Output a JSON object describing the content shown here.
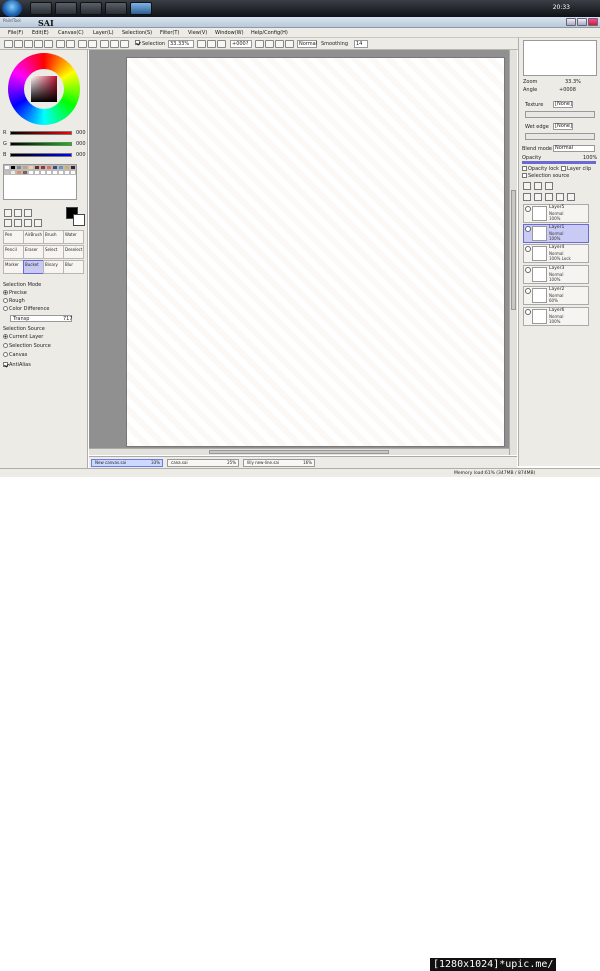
{
  "taskbar": {
    "clock": "20:33"
  },
  "window": {
    "title": "SAI",
    "subtitle": "PaintTool"
  },
  "menu": [
    "File(F)",
    "Edit(E)",
    "Canvas(C)",
    "Layer(L)",
    "Selection(S)",
    "Filter(T)",
    "View(V)",
    "Window(W)",
    "Help/Config(H)"
  ],
  "toolbar": {
    "selection_label": "Selection",
    "zoom": "33.33%",
    "angle": "+000?",
    "mode": "Normal",
    "smoothing_label": "Smoothing",
    "smoothing_value": "14"
  },
  "color": {
    "r_label": "R",
    "r_value": "000",
    "g_label": "G",
    "g_value": "000",
    "b_label": "B",
    "b_value": "000",
    "selected": "#c01030"
  },
  "tools": [
    {
      "label": "Pen"
    },
    {
      "label": "AirBrush"
    },
    {
      "label": "Brush"
    },
    {
      "label": "Water"
    },
    {
      "label": "Pencil"
    },
    {
      "label": "Eraser"
    },
    {
      "label": "Select"
    },
    {
      "label": "Deselect"
    },
    {
      "label": "Marker"
    },
    {
      "label": "Bucket"
    },
    {
      "label": "Binary"
    },
    {
      "label": "Blur"
    }
  ],
  "selection_mode": {
    "title": "Selection Mode",
    "options": [
      "Precise",
      "Rough",
      "Color Difference"
    ],
    "threshold_label": "Transp",
    "threshold_value": "717"
  },
  "selection_source": {
    "title": "Selection Source",
    "options": [
      "Current Layer",
      "Selection Source",
      "Canvas"
    ],
    "antialias": "AntiAlias"
  },
  "file_tabs": [
    {
      "name": "New canvas.sai",
      "pct": "33%"
    },
    {
      "name": "cana.sai",
      "pct": "25%"
    },
    {
      "name": "lilly new-line.sai",
      "pct": "16%"
    }
  ],
  "right": {
    "zoom_label": "Zoom",
    "zoom_value": "33.3%",
    "angle_label": "Angle",
    "angle_value": "+0008",
    "texture_label": "Texture",
    "texture_value": "[None]",
    "wetedge_label": "Wet edge",
    "wetedge_value": "[None]",
    "blend_label": "Blend mode",
    "blend_value": "Normal",
    "opacity_label": "Opacity",
    "opacity_value": "100%",
    "opacity_lock": "Opacity lock",
    "layer_clip": "Layer clip",
    "selection_source": "Selection source"
  },
  "layers": [
    {
      "name": "Layer5",
      "mode": "Normal",
      "opacity": "100%"
    },
    {
      "name": "Layer1",
      "mode": "Normal",
      "opacity": "100%"
    },
    {
      "name": "Layer4",
      "mode": "Normal",
      "opacity": "100% Lock"
    },
    {
      "name": "Layer3",
      "mode": "Normal",
      "opacity": "100%"
    },
    {
      "name": "Layer2",
      "mode": "Normal",
      "opacity": "60%"
    },
    {
      "name": "Layer6",
      "mode": "Normal",
      "opacity": "100%"
    }
  ],
  "status": {
    "memory": "Memory load:61% (347MB / 874MB)"
  },
  "watermark": "[1280x1024]*upic.me/"
}
